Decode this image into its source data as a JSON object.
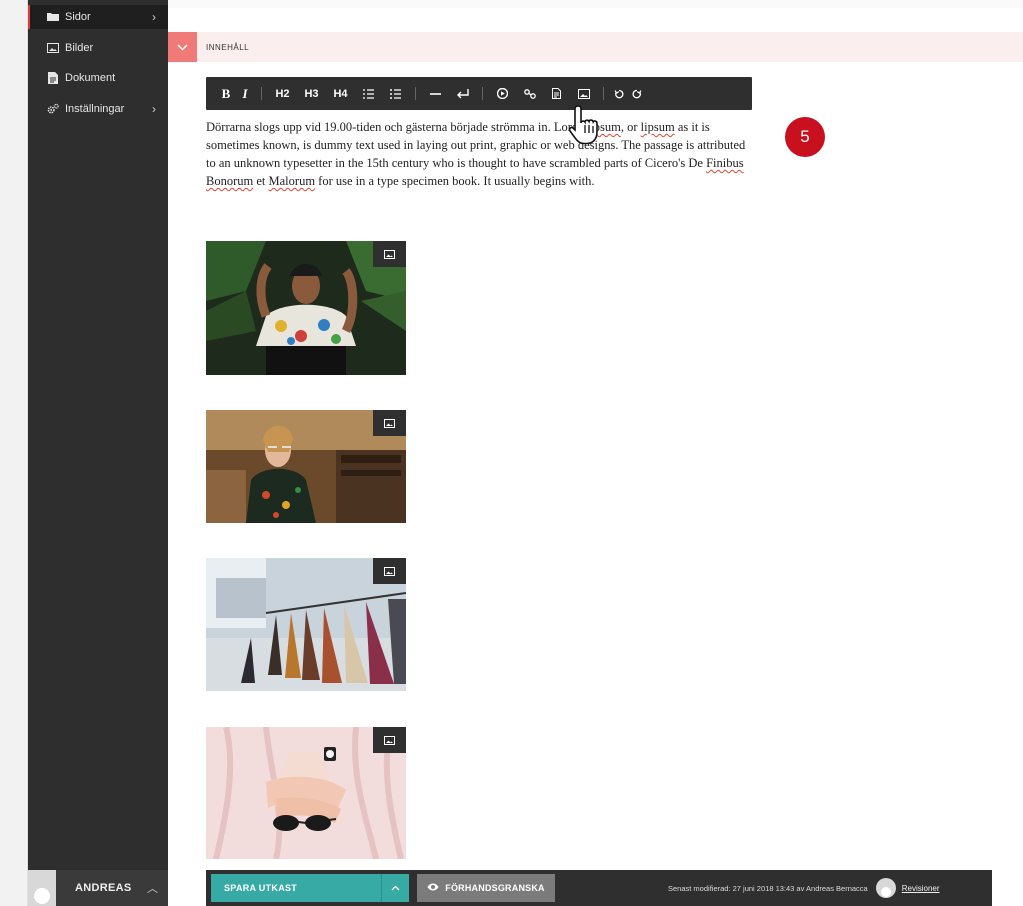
{
  "sidebar": {
    "items": [
      {
        "label": "Sidor",
        "icon": "folder-icon",
        "has_chevron": true,
        "active": true
      },
      {
        "label": "Bilder",
        "icon": "image-icon",
        "has_chevron": false
      },
      {
        "label": "Dokument",
        "icon": "document-icon",
        "has_chevron": false
      },
      {
        "label": "Inställningar",
        "icon": "gears-icon",
        "has_chevron": true
      }
    ],
    "user": {
      "name": "ANDREAS",
      "chevron": "^"
    }
  },
  "section": {
    "title": "INNEHÅLL"
  },
  "toolbar": {
    "buttons": [
      "B",
      "I",
      "H2",
      "H3",
      "H4",
      "ordered-list",
      "unordered-list",
      "horizontal-rule",
      "line-break",
      "video",
      "link",
      "file",
      "image",
      "undo",
      "redo"
    ]
  },
  "content": {
    "paragraph_parts": {
      "p1": "Dörrarna slogs upp vid 19.00-tiden och gästerna började strömma in. Lorem ",
      "w_ipsum": "ipsum",
      "p2": ", or ",
      "w_lipsum": "lipsum",
      "p3": " as it is sometimes known, is dummy text used in laying out print, graphic or web designs. The passage is attributed to an unknown typesetter in the 15th century who is thought to have scrambled parts of Cicero's De ",
      "w_finibus": "Finibus",
      "p4": " ",
      "w_bonorum": "Bonorum",
      "p5": " et ",
      "w_malorum": "Malorum",
      "p6": " for use in a type specimen book. It usually begins with."
    }
  },
  "step_badge": "5",
  "footer": {
    "save_label": "SPARA UTKAST",
    "preview_label": "FÖRHANDSGRANSKA",
    "modified_text": "Senast modifierad: 27 juni 2018 13:43 av Andreas Bernacca",
    "revisions_label": "Revisioner"
  },
  "colors": {
    "sidebar": "#2e2e2e",
    "accent_red": "#c8101e",
    "section_tint": "#fbeeee",
    "section_toggle": "#ef7a78",
    "save_teal": "#37aaa6"
  }
}
